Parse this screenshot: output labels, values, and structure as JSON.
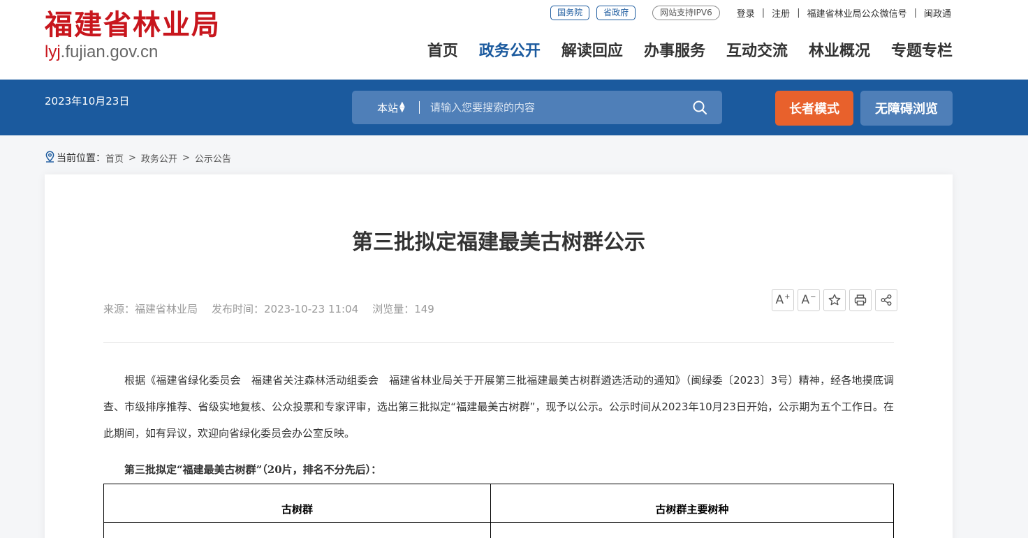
{
  "header": {
    "logo_title": "福建省林业局",
    "logo_domain_highlight": "lyj",
    "logo_domain_rest": ".fujian.gov.cn",
    "top_links": {
      "pill1": "国务院",
      "pill2": "省政府",
      "ipv6": "网站支持IPV6",
      "login": "登录",
      "register": "注册",
      "wechat": "福建省林业局公众微信号",
      "mzt": "闽政通"
    },
    "nav": [
      {
        "label": "首页"
      },
      {
        "label": "政务公开",
        "active": true
      },
      {
        "label": "解读回应"
      },
      {
        "label": "办事服务"
      },
      {
        "label": "互动交流"
      },
      {
        "label": "林业概况"
      },
      {
        "label": "专题专栏"
      }
    ]
  },
  "bar": {
    "date": "2023年10月23日",
    "search_scope": "本站",
    "search_placeholder": "请输入您要搜索的内容",
    "elder_mode": "长者模式",
    "accessible": "无障碍浏览"
  },
  "breadcrumb": {
    "label": "当前位置：",
    "items": [
      "首页",
      "政务公开",
      "公示公告"
    ]
  },
  "article": {
    "title": "第三批拟定福建最美古树群公示",
    "source": "来源：福建省林业局",
    "published": "发布时间：2023-10-23 11:04",
    "views": "浏览量：149",
    "paragraph": "根据《福建省绿化委员会　福建省关注森林活动组委会　福建省林业局关于开展第三批福建最美古树群遴选活动的通知》（闽绿委〔2023〕3号）精神，经各地摸底调查、市级排序推荐、省级实地复核、公众投票和专家评审，选出第三批拟定“福建最美古树群”，现予以公示。公示时间从2023年10月23日开始，公示期为五个工作日。在此期间，如有异议，欢迎向省绿化委员会办公室反映。",
    "subhead": "第三批拟定“福建最美古树群”（20片，排名不分先后）：",
    "table_headers": [
      "古树群",
      "古树群主要树种"
    ]
  },
  "colors": {
    "brand_red": "#c8161d",
    "brand_blue": "#1b5a9e",
    "elder_orange": "#e8612c"
  }
}
